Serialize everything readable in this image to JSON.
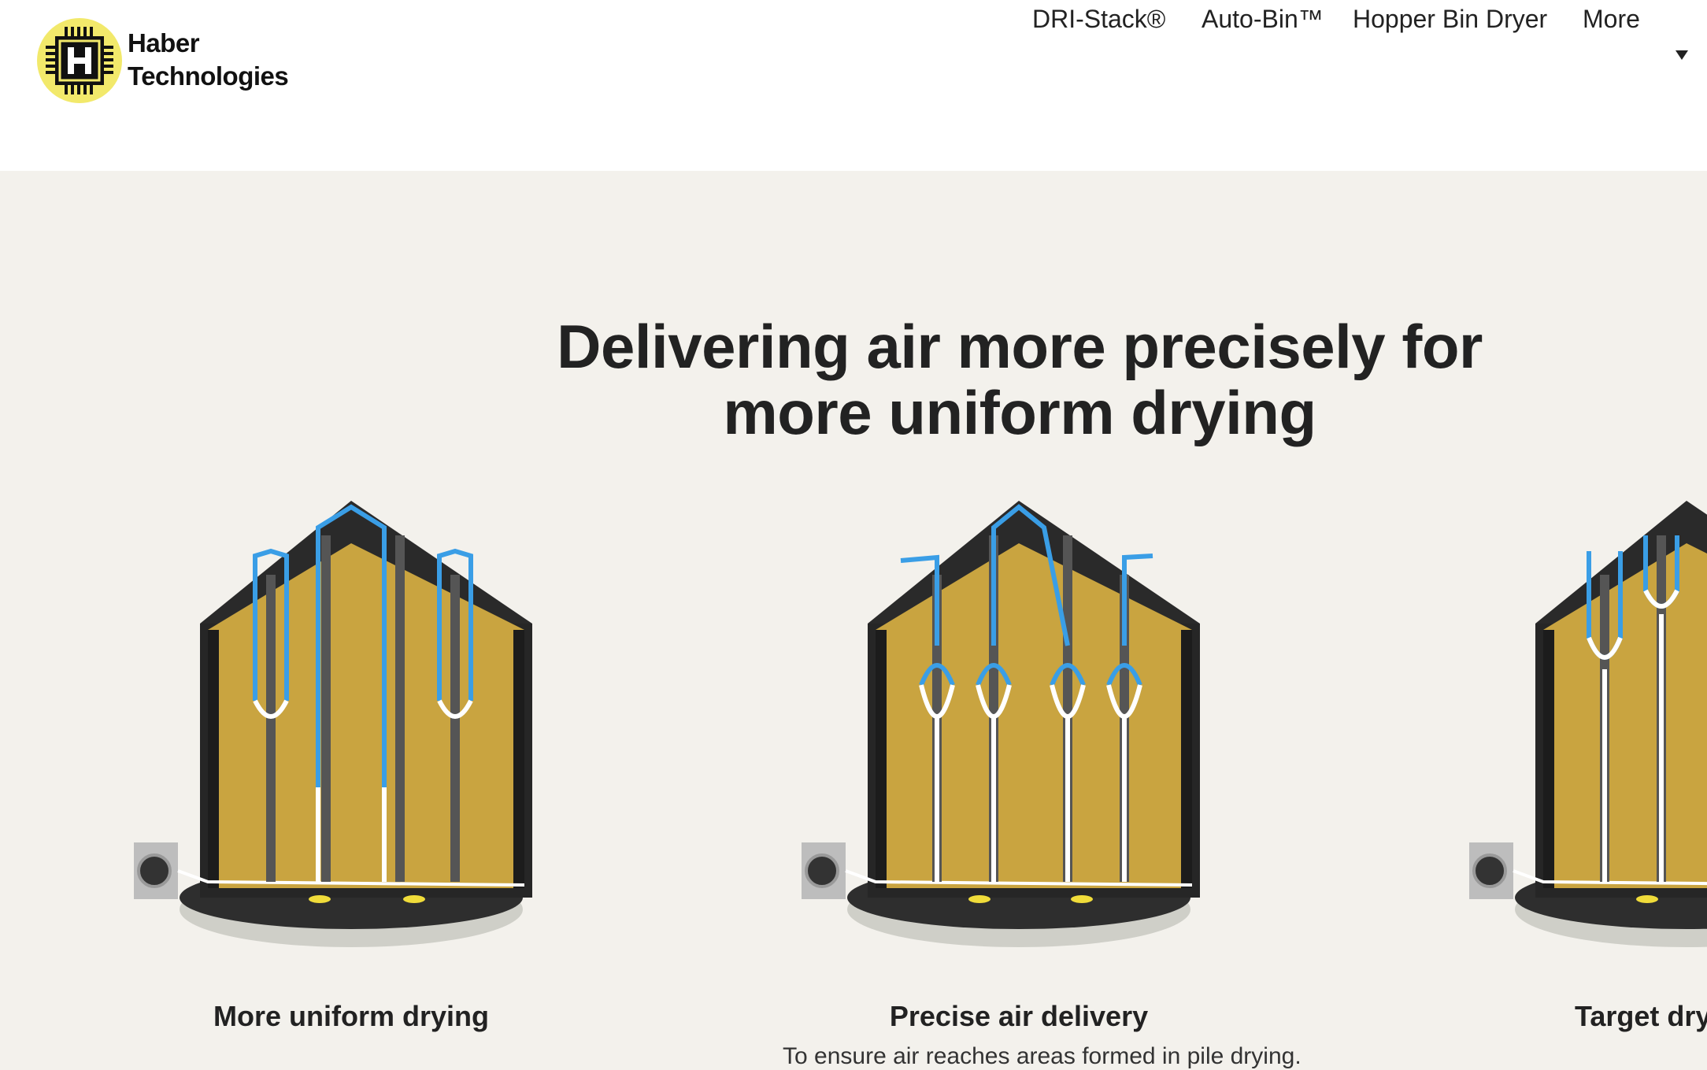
{
  "brand": {
    "name_line1": "Haber",
    "name_line2": "Technologies",
    "logo_icon": "h-chip-logo-icon",
    "logo_color": "#f2e96b"
  },
  "nav": {
    "items": [
      {
        "label": "DRI-Stack®"
      },
      {
        "label": "Auto-Bin™"
      },
      {
        "label": "Hopper Bin Dryer"
      },
      {
        "label": "More"
      }
    ],
    "more_icon": "caret-down-icon"
  },
  "hero": {
    "title": "Delivering air more precisely for more uniform drying"
  },
  "features": [
    {
      "title": "More uniform drying",
      "image": "grain-bin-cutaway-image",
      "body": ""
    },
    {
      "title": "Precise air delivery",
      "image": "grain-bin-cutaway-image",
      "body": "To ensure air reaches areas formed in pile drying."
    },
    {
      "title": "Target dry",
      "image": "grain-bin-cutaway-image",
      "body": ""
    }
  ],
  "colors": {
    "page_bg": "#f3f1ec",
    "header_bg": "#ffffff",
    "grain": "#c9a440",
    "airflow": "#3a9ee6",
    "roof": "#2b2b2b"
  }
}
